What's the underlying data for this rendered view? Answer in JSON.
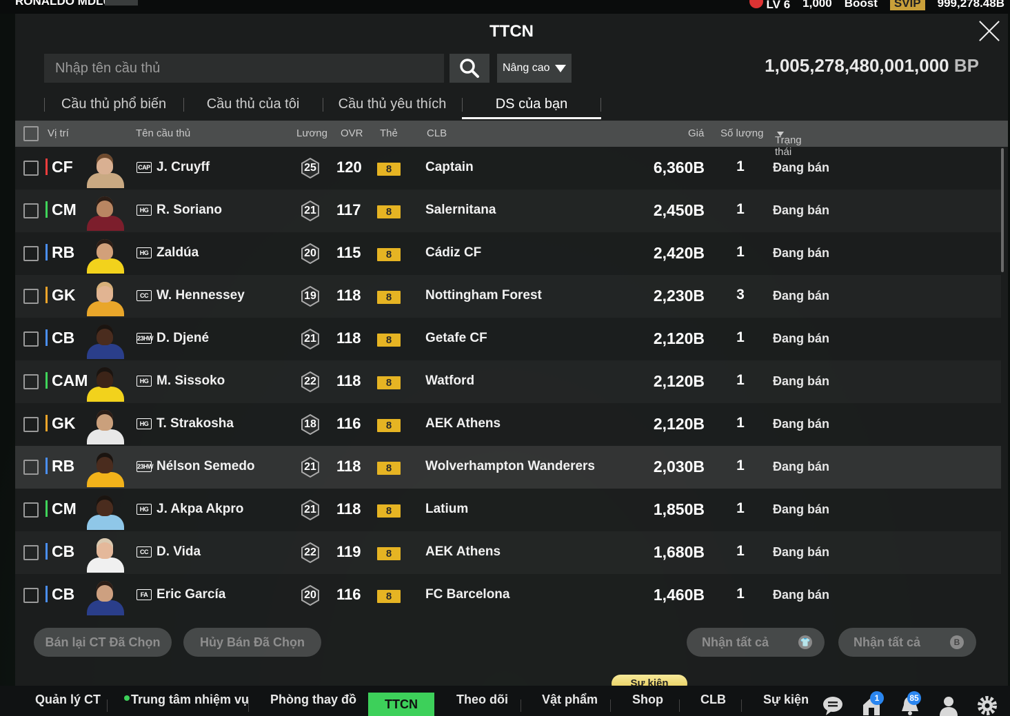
{
  "top_bar": {
    "left_text": "RONALDO MDLU",
    "level": "LV 6",
    "coins": "1,000",
    "boost": "Boost",
    "svip": "SVIP",
    "bp_short": "999,278.48B"
  },
  "panel": {
    "title": "TTCN"
  },
  "search": {
    "placeholder": "Nhập tên cầu thủ",
    "advanced_label": "Nâng cao"
  },
  "balance": {
    "amount": "1,005,278,480,001,000",
    "unit": "BP"
  },
  "tabs": [
    {
      "label": "Cầu thủ phổ biến"
    },
    {
      "label": "Cầu thủ của tôi"
    },
    {
      "label": "Cầu thủ yêu thích"
    },
    {
      "label": "DS của bạn"
    }
  ],
  "columns": {
    "position": "Vị trí",
    "name": "Tên cầu thủ",
    "salary": "Lương",
    "ovr": "OVR",
    "card": "Thẻ",
    "club": "CLB",
    "price": "Giá",
    "quantity": "Số lượng",
    "status": "Trạng thái"
  },
  "players": [
    {
      "pos": "CF",
      "role": "att",
      "season": "CAP",
      "name": "J. Cruyff",
      "salary": "25",
      "ovr": "120",
      "level": "8",
      "club": "Captain",
      "price": "6,360B",
      "qty": "1",
      "status": "Đang bán"
    },
    {
      "pos": "CM",
      "role": "mid",
      "season": "HG",
      "name": "R. Soriano",
      "salary": "21",
      "ovr": "117",
      "level": "8",
      "club": "Salernitana",
      "price": "2,450B",
      "qty": "1",
      "status": "Đang bán"
    },
    {
      "pos": "RB",
      "role": "def",
      "season": "HG",
      "name": "Zaldúa",
      "salary": "20",
      "ovr": "115",
      "level": "8",
      "club": "Cádiz CF",
      "price": "2,420B",
      "qty": "1",
      "status": "Đang bán"
    },
    {
      "pos": "GK",
      "role": "gk",
      "season": "CC",
      "name": "W. Hennessey",
      "salary": "19",
      "ovr": "118",
      "level": "8",
      "club": "Nottingham Forest",
      "price": "2,230B",
      "qty": "3",
      "status": "Đang bán"
    },
    {
      "pos": "CB",
      "role": "def",
      "season": "23HW",
      "name": "D. Djené",
      "salary": "21",
      "ovr": "118",
      "level": "8",
      "club": "Getafe CF",
      "price": "2,120B",
      "qty": "1",
      "status": "Đang bán"
    },
    {
      "pos": "CAM",
      "role": "mid",
      "season": "HG",
      "name": "M. Sissoko",
      "salary": "22",
      "ovr": "118",
      "level": "8",
      "club": "Watford",
      "price": "2,120B",
      "qty": "1",
      "status": "Đang bán"
    },
    {
      "pos": "GK",
      "role": "gk",
      "season": "HG",
      "name": "T. Strakosha",
      "salary": "18",
      "ovr": "116",
      "level": "8",
      "club": "AEK Athens",
      "price": "2,120B",
      "qty": "1",
      "status": "Đang bán"
    },
    {
      "pos": "RB",
      "role": "def",
      "season": "23HW",
      "name": "Nélson Semedo",
      "salary": "21",
      "ovr": "118",
      "level": "8",
      "club": "Wolverhampton Wanderers",
      "price": "2,030B",
      "qty": "1",
      "status": "Đang bán"
    },
    {
      "pos": "CM",
      "role": "mid",
      "season": "HG",
      "name": "J. Akpa Akpro",
      "salary": "21",
      "ovr": "118",
      "level": "8",
      "club": "Latium",
      "price": "1,850B",
      "qty": "1",
      "status": "Đang bán"
    },
    {
      "pos": "CB",
      "role": "def",
      "season": "CC",
      "name": "D. Vida",
      "salary": "22",
      "ovr": "119",
      "level": "8",
      "club": "AEK Athens",
      "price": "1,680B",
      "qty": "1",
      "status": "Đang bán"
    },
    {
      "pos": "CB",
      "role": "def",
      "season": "FA",
      "name": "Eric García",
      "salary": "20",
      "ovr": "116",
      "level": "8",
      "club": "FC Barcelona",
      "price": "1,460B",
      "qty": "1",
      "status": "Đang bán"
    }
  ],
  "actions": {
    "resell": "Bán lại CT Đã Chọn",
    "cancel": "Hủy Bán Đã Chọn",
    "claim_all_1": "Nhận tất cả",
    "claim_all_2": "Nhận tất cả"
  },
  "bottom_nav": {
    "items": [
      "Quản lý CT",
      "Trung tâm nhiệm vụ",
      "Phòng thay đồ",
      "TTCN",
      "Theo dõi",
      "Vật phẩm",
      "Shop",
      "CLB",
      "Sự kiện"
    ],
    "event_badge": "Sự kiện",
    "mail_count": "1",
    "notif_count": "85"
  },
  "colors": {
    "active_green": "#3dd05a",
    "level_gold": "#e6b423",
    "att": "#ef3d3d",
    "mid": "#3fd45a",
    "def": "#4a8ff5",
    "gk": "#f0a52a"
  }
}
